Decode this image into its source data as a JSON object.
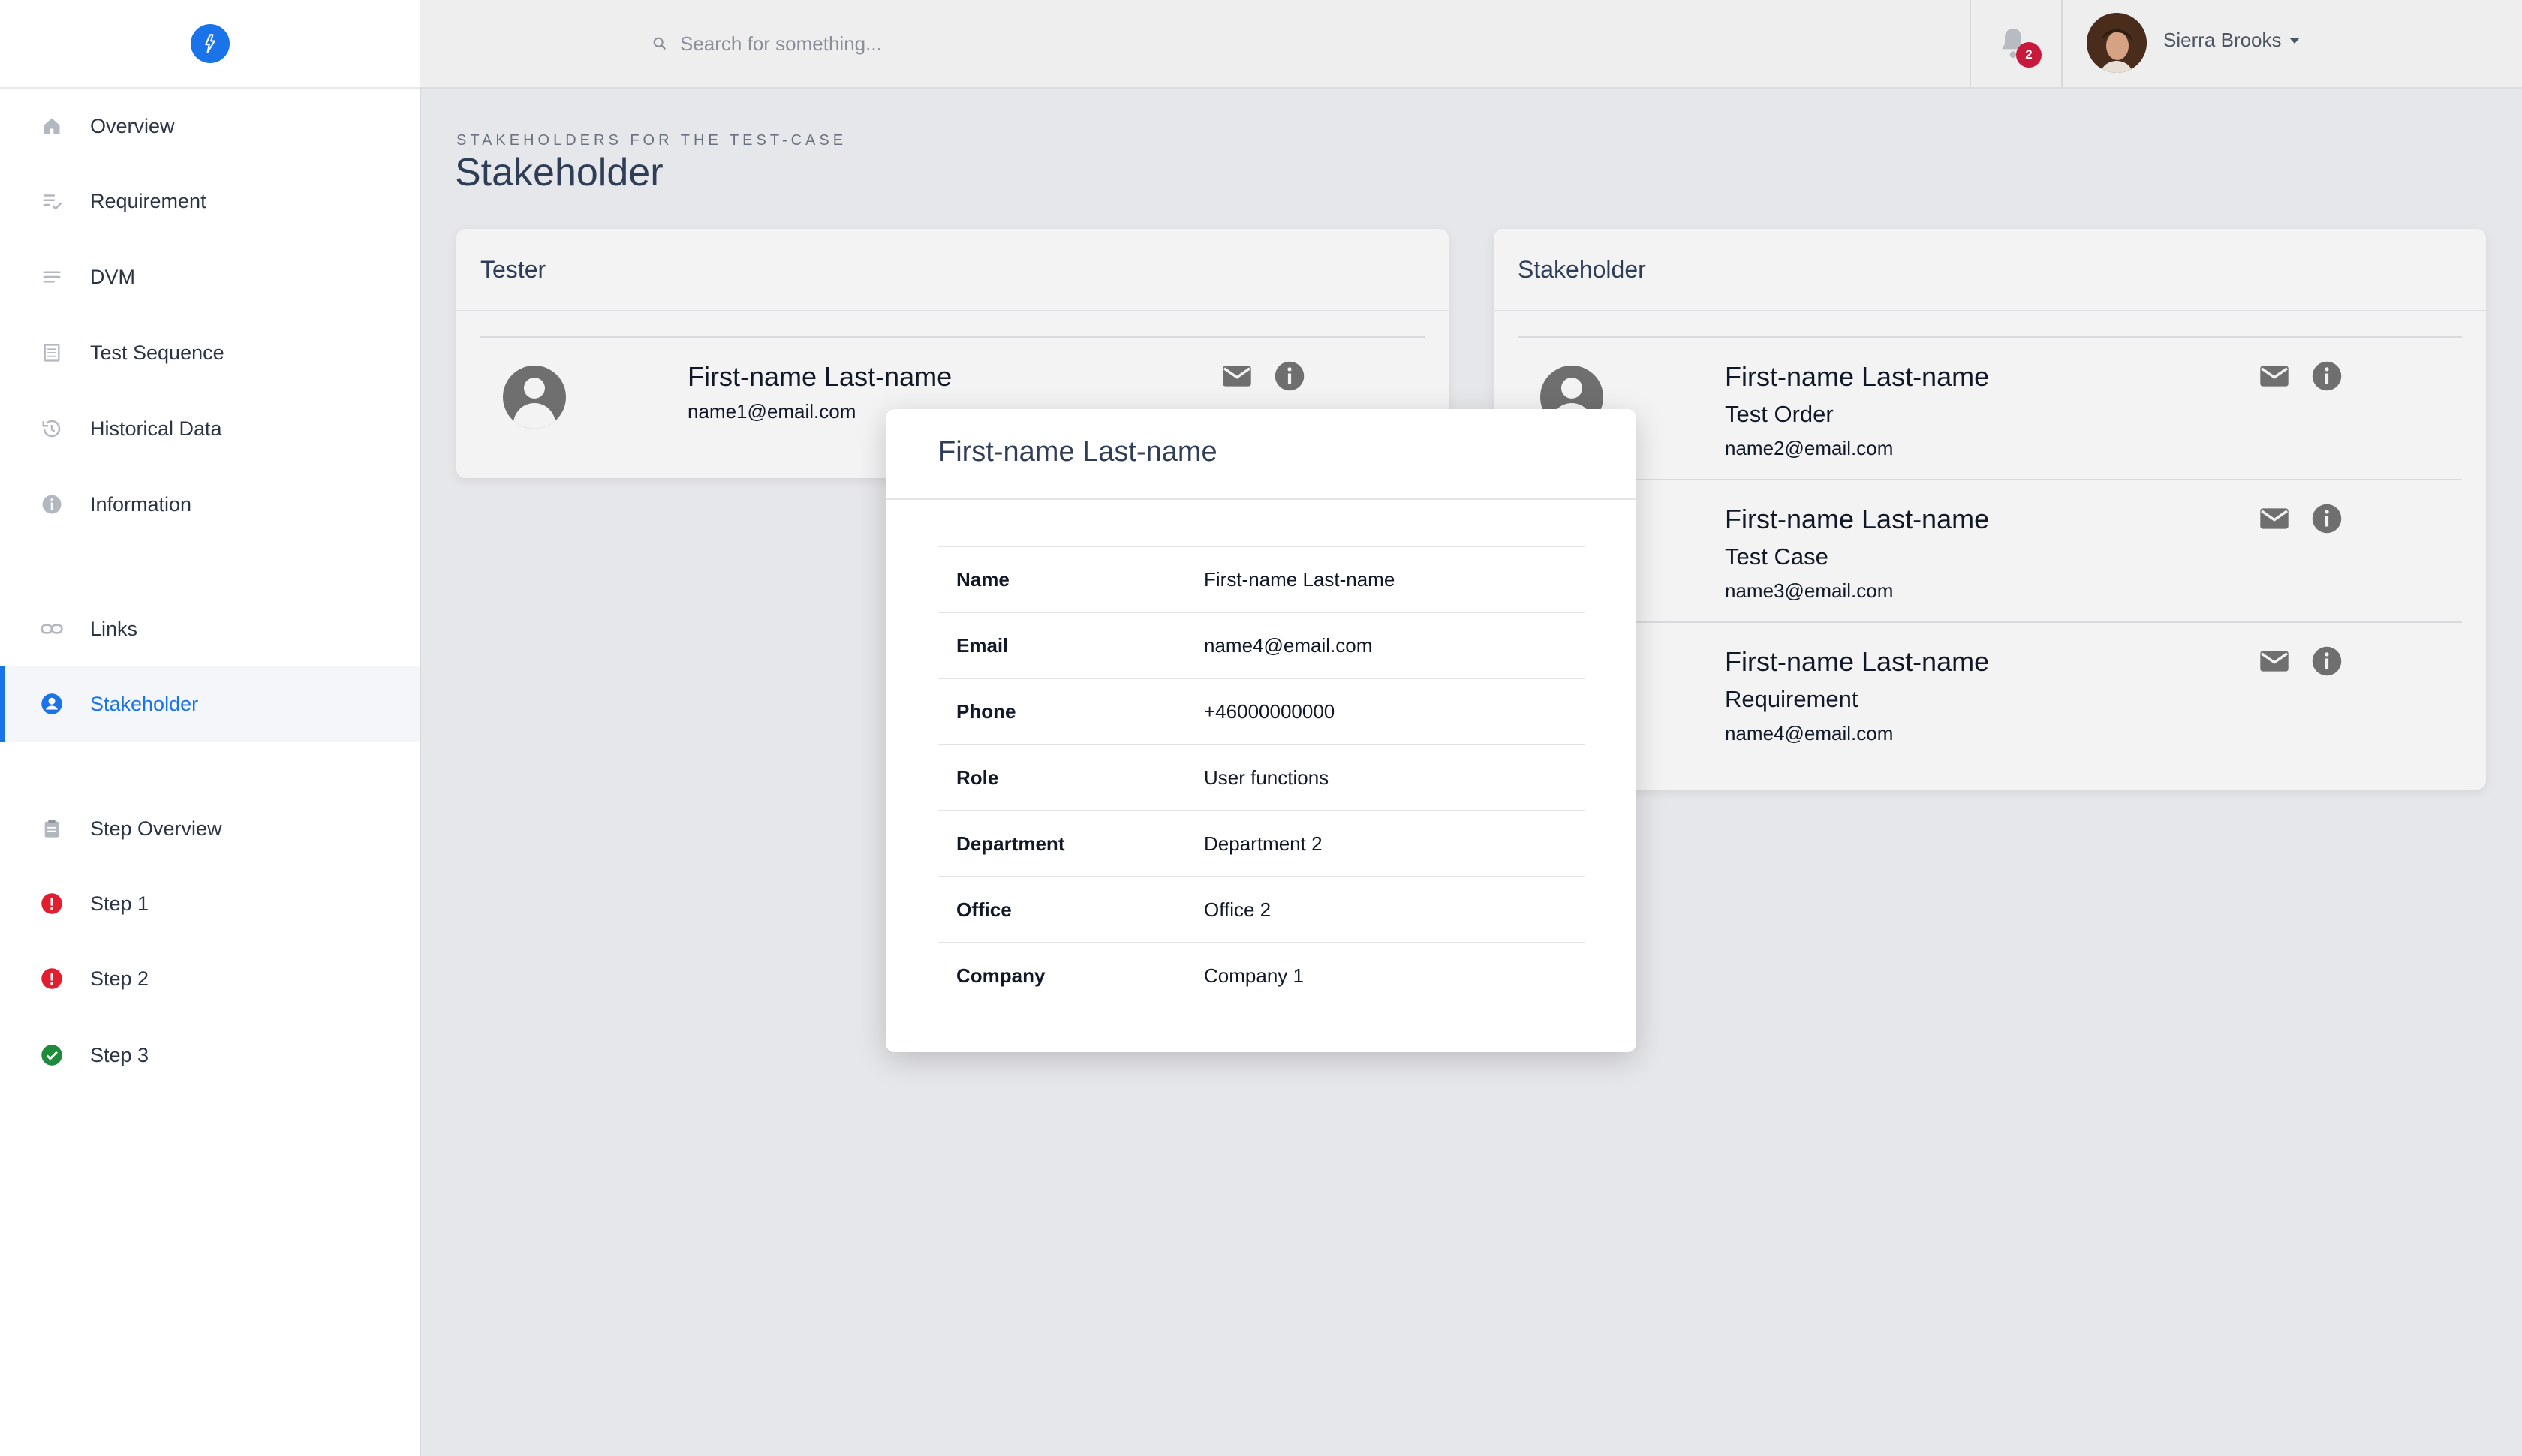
{
  "sidebar": {
    "items": [
      {
        "label": "Overview",
        "icon": "home-icon"
      },
      {
        "label": "Requirement",
        "icon": "list-check-icon"
      },
      {
        "label": "DVM",
        "icon": "lines-icon"
      },
      {
        "label": "Test Sequence",
        "icon": "document-list-icon"
      },
      {
        "label": "Historical Data",
        "icon": "history-icon"
      },
      {
        "label": "Information",
        "icon": "info-icon"
      },
      {
        "label": "Links",
        "icon": "link-icon"
      },
      {
        "label": "Stakeholder",
        "icon": "user-circle-icon",
        "active": true
      },
      {
        "label": "Step Overview",
        "icon": "clipboard-icon"
      },
      {
        "label": "Step 1",
        "icon": "error-icon",
        "status": "error"
      },
      {
        "label": "Step 2",
        "icon": "error-icon",
        "status": "error"
      },
      {
        "label": "Step 3",
        "icon": "check-circle-icon",
        "status": "ok"
      }
    ]
  },
  "topbar": {
    "search_placeholder": "Search for something...",
    "notifications_count": "2",
    "user_name": "Sierra Brooks"
  },
  "header": {
    "kicker": "STAKEHOLDERS FOR THE TEST-CASE",
    "title": "Stakeholder"
  },
  "tester_card": {
    "title": "Tester",
    "person": {
      "name": "First-name Last-name",
      "email": "name1@email.com"
    }
  },
  "stakeholder_card": {
    "title": "Stakeholder",
    "people": [
      {
        "name": "First-name Last-name",
        "role": "Test Order",
        "email": "name2@email.com"
      },
      {
        "name": "First-name Last-name",
        "role": "Test Case",
        "email": "name3@email.com"
      },
      {
        "name": "First-name Last-name",
        "role": "Requirement",
        "email": "name4@email.com"
      }
    ]
  },
  "modal": {
    "title": "First-name Last-name",
    "rows": [
      {
        "key": "Name",
        "value": "First-name Last-name"
      },
      {
        "key": "Email",
        "value": "name4@email.com"
      },
      {
        "key": "Phone",
        "value": "+46000000000"
      },
      {
        "key": "Role",
        "value": "User functions"
      },
      {
        "key": "Department",
        "value": "Department 2"
      },
      {
        "key": "Office",
        "value": "Office 2"
      },
      {
        "key": "Company",
        "value": "Company 1"
      }
    ]
  },
  "colors": {
    "accent": "#1a73e8",
    "error": "#e11d2e",
    "ok": "#1f8a3b",
    "badge": "#c8183c"
  }
}
